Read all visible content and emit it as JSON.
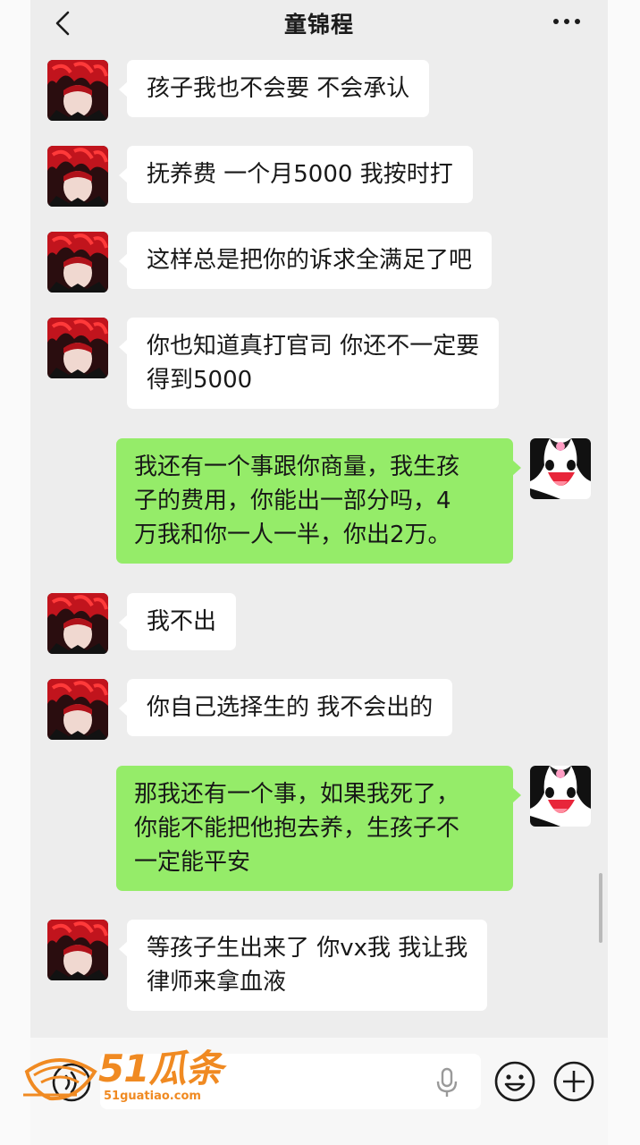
{
  "header": {
    "title": "童锦程",
    "back_icon": "chevron-left-icon",
    "more_icon": "more-dots-icon"
  },
  "messages": [
    {
      "side": "in",
      "lines": [
        "孩子我也不会要 不会承认"
      ]
    },
    {
      "side": "in",
      "lines": [
        "抚养费 一个月5000 我按时打"
      ]
    },
    {
      "side": "in",
      "lines": [
        "这样总是把你的诉求全满足了吧"
      ]
    },
    {
      "side": "in",
      "lines": [
        "你也知道真打官司 你还不一定要",
        "得到5000"
      ]
    },
    {
      "side": "out",
      "lines": [
        "我还有一个事跟你商量，我生孩",
        "子的费用，你能出一部分吗，4",
        "万我和你一人一半，你出2万。"
      ]
    },
    {
      "side": "in",
      "lines": [
        "我不出"
      ]
    },
    {
      "side": "in",
      "lines": [
        "你自己选择生的 我不会出的"
      ]
    },
    {
      "side": "out",
      "lines": [
        "那我还有一个事，如果我死了，",
        "你能不能把他抱去养，生孩子不",
        "一定能平安"
      ]
    },
    {
      "side": "in",
      "lines": [
        "等孩子生出来了 你vx我 我让我",
        "律师来拿血液"
      ]
    }
  ],
  "input_bar": {
    "voice_icon": "voice-icon",
    "mic_icon": "microphone-icon",
    "emoji_icon": "emoji-icon",
    "add_icon": "plus-circle-icon"
  },
  "watermark": {
    "main": "51瓜条",
    "sub": "51guatiao.com"
  },
  "colors": {
    "background": "#ededed",
    "incoming_bubble": "#ffffff",
    "outgoing_bubble": "#95ec69",
    "watermark": "#f08a22"
  }
}
